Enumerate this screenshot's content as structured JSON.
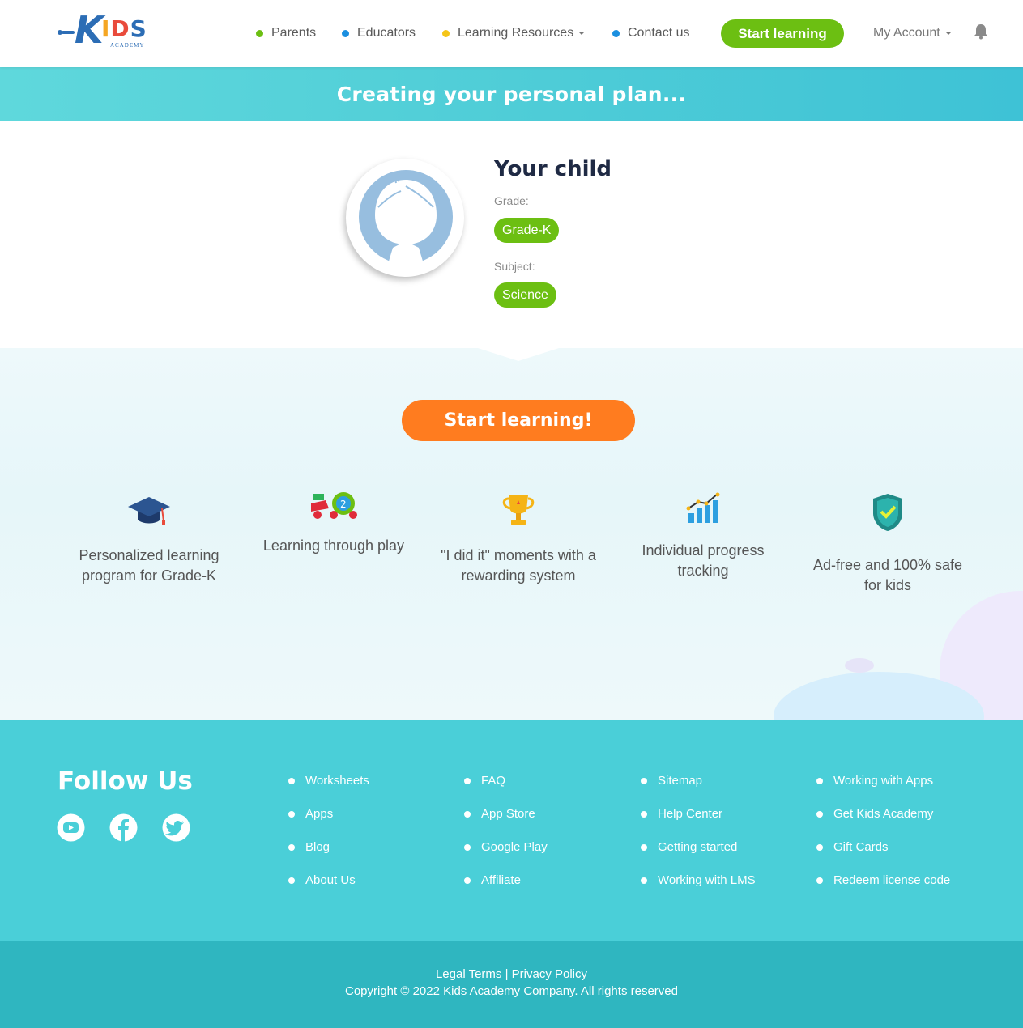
{
  "header": {
    "logo_main": "IDS",
    "logo_k": "K",
    "logo_sub": "ACADEMY",
    "nav": [
      {
        "label": "Parents",
        "color": "#6cbf12"
      },
      {
        "label": "Educators",
        "color": "#1a8fe0"
      },
      {
        "label": "Learning Resources",
        "color": "#f5c518"
      },
      {
        "label": "Contact us",
        "color": "#1a8fe0"
      }
    ],
    "start_button": "Start learning",
    "account": "My Account"
  },
  "banner": {
    "title": "Creating your personal plan..."
  },
  "profile": {
    "name": "Your child",
    "grade_label": "Grade:",
    "grade_value": "Grade-K",
    "subject_label": "Subject:",
    "subject_value": "Science"
  },
  "cta": {
    "label": "Start learning!"
  },
  "features": [
    {
      "icon": "graduation-cap-icon",
      "text": "Personalized learning program for Grade-K"
    },
    {
      "icon": "toy-car-icon",
      "text": "Learning through play"
    },
    {
      "icon": "trophy-icon",
      "text": "\"I did it\" moments with a rewarding system"
    },
    {
      "icon": "progress-chart-icon",
      "text": "Individual progress tracking"
    },
    {
      "icon": "shield-check-icon",
      "text": "Ad-free and 100% safe for kids"
    }
  ],
  "footer": {
    "follow_title": "Follow Us",
    "social": [
      "youtube-icon",
      "facebook-icon",
      "twitter-icon"
    ],
    "columns": [
      [
        "Worksheets",
        "Apps",
        "Blog",
        "About Us"
      ],
      [
        "FAQ",
        "App Store",
        "Google Play",
        "Affiliate"
      ],
      [
        "Sitemap",
        "Help Center",
        "Getting started",
        "Working with LMS"
      ],
      [
        "Working with Apps",
        "Get Kids Academy",
        "Gift Cards",
        "Redeem license code"
      ]
    ],
    "legal": "Legal Terms",
    "separator": "|",
    "privacy": "Privacy Policy",
    "copyright": "Copyright © 2022 Kids Academy Company. All rights reserved"
  },
  "colors": {
    "green": "#6cbf12",
    "orange": "#ff7c1f",
    "teal": "#4acfd8",
    "teal_dark": "#2fb6c0"
  }
}
